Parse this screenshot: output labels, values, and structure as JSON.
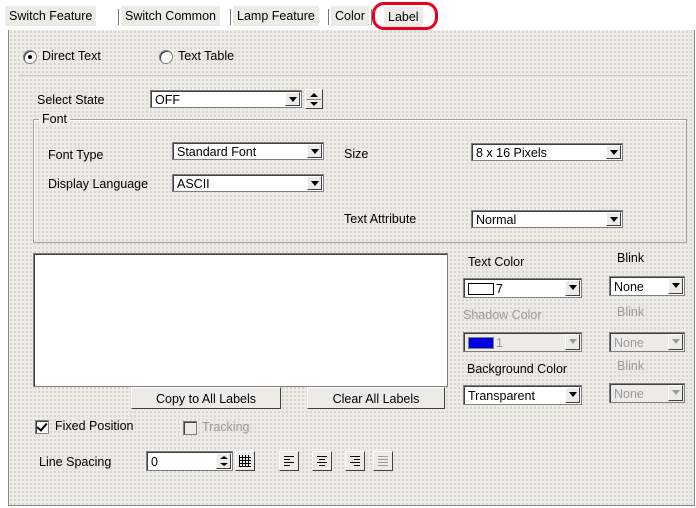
{
  "tabs": [
    {
      "label": "Switch Feature"
    },
    {
      "label": "Switch Common"
    },
    {
      "label": "Lamp Feature"
    },
    {
      "label": "Color"
    },
    {
      "label": "Label",
      "active": true
    }
  ],
  "text_mode": {
    "direct": "Direct Text",
    "table": "Text Table",
    "selected": "direct"
  },
  "select_state": {
    "label": "Select State",
    "value": "OFF"
  },
  "font": {
    "group_label": "Font",
    "font_type_label": "Font Type",
    "font_type_value": "Standard Font",
    "display_language_label": "Display Language",
    "display_language_value": "ASCII",
    "size_label": "Size",
    "size_value": "8 x 16 Pixels",
    "text_attribute_label": "Text Attribute",
    "text_attribute_value": "Normal"
  },
  "colors": {
    "text_color_label": "Text Color",
    "text_color_value": "7",
    "text_blink_label": "Blink",
    "text_blink_value": "None",
    "shadow_color_label": "Shadow Color",
    "shadow_color_value": "1",
    "shadow_blink_label": "Blink",
    "shadow_blink_value": "None",
    "bg_color_label": "Background Color",
    "bg_color_value": "Transparent",
    "bg_blink_label": "Blink",
    "bg_blink_value": "None",
    "highlight": "#e8001c",
    "shadow_swatch": "#0000e0"
  },
  "buttons": {
    "copy": "Copy to All Labels",
    "clear": "Clear All Labels"
  },
  "fixed_position": {
    "label": "Fixed Position",
    "checked": true
  },
  "tracking": {
    "label": "Tracking",
    "checked": false
  },
  "line_spacing": {
    "label": "Line Spacing",
    "value": "0"
  }
}
